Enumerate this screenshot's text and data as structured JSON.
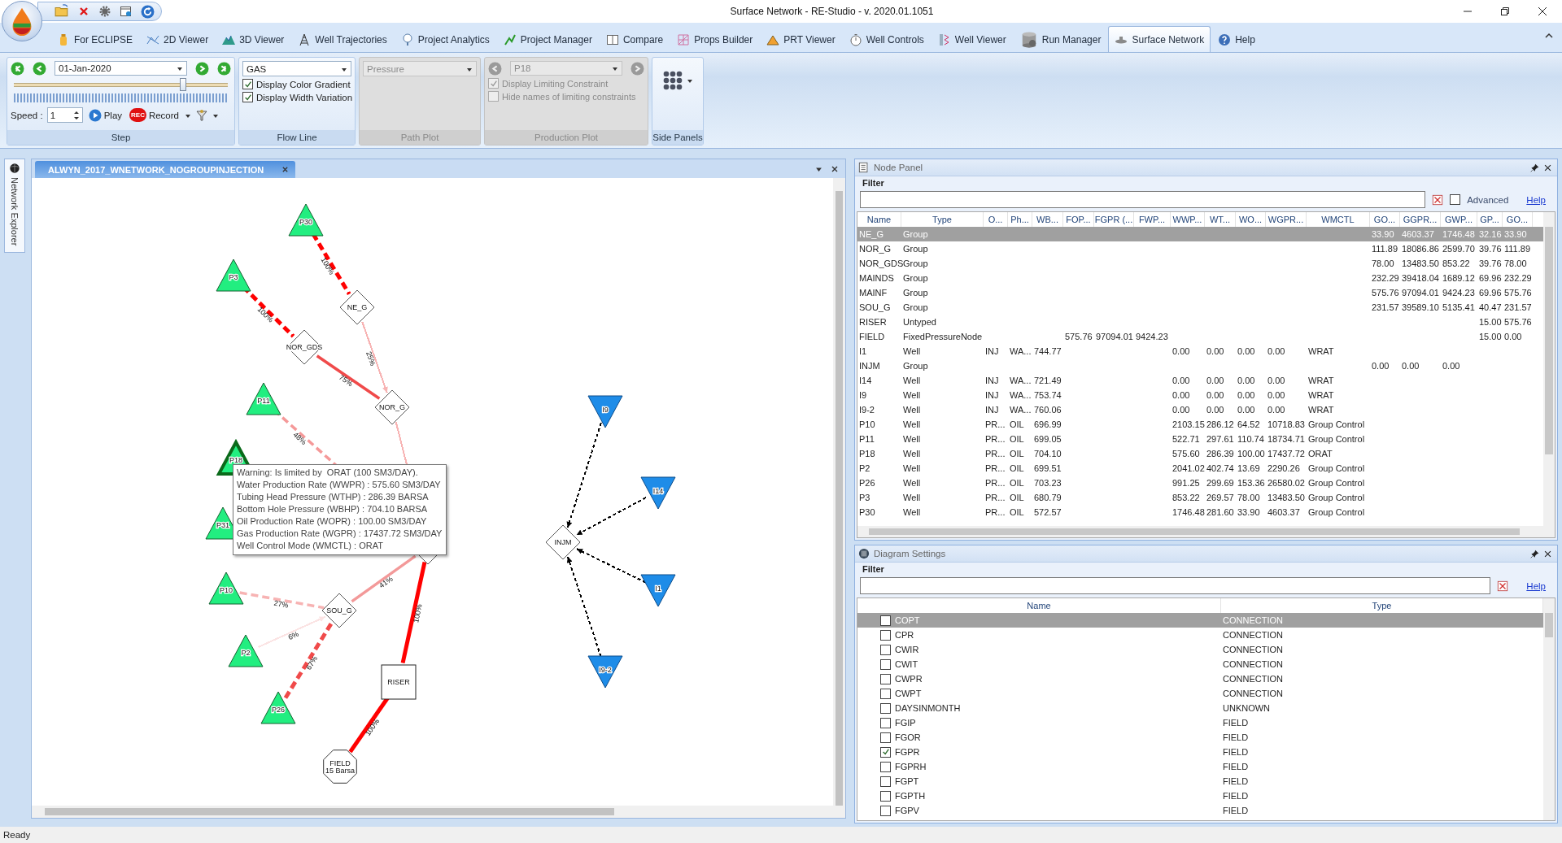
{
  "window": {
    "title": "Surface Network - RE-Studio - v. 2020.01.1051"
  },
  "ribbon": {
    "tabs": [
      {
        "label": "For ECLIPSE",
        "selected": false
      },
      {
        "label": "2D Viewer",
        "selected": false
      },
      {
        "label": "3D Viewer",
        "selected": false
      },
      {
        "label": "Well Trajectories",
        "selected": false
      },
      {
        "label": "Project Analytics",
        "selected": false
      },
      {
        "label": "Project Manager",
        "selected": false
      },
      {
        "label": "Compare",
        "selected": false
      },
      {
        "label": "Props Builder",
        "selected": false
      },
      {
        "label": "PRT Viewer",
        "selected": false
      },
      {
        "label": "Well Controls",
        "selected": false
      },
      {
        "label": "Well Viewer",
        "selected": false
      },
      {
        "label": "Run Manager",
        "selected": false
      },
      {
        "label": "Surface Network",
        "selected": true
      },
      {
        "label": "Help",
        "selected": false
      }
    ],
    "step": {
      "label": "Step",
      "date": "01-Jan-2020",
      "slider": {
        "level": 0.79
      },
      "speed_label": "Speed :",
      "speed": "1",
      "play": "Play",
      "record_badge": "REC",
      "record": "Record"
    },
    "flow_line": {
      "label": "Flow Line",
      "fluid": "GAS",
      "options": [
        {
          "label": "Display Color Gradient",
          "checked": true
        },
        {
          "label": "Display Width Variation",
          "checked": true
        }
      ]
    },
    "path_plot": {
      "label": "Path Plot",
      "variable": "Pressure",
      "disabled": true
    },
    "production_plot": {
      "label": "Production Plot",
      "well": "P18",
      "disabled": true,
      "options": [
        {
          "label": "Display Limiting Constraint",
          "checked": true
        },
        {
          "label": "Hide names of limiting constraints",
          "checked": false
        }
      ]
    },
    "side_panels": {
      "label": "Side Panels"
    }
  },
  "sidebar": {
    "tabs": [
      {
        "label": "Network Explorer"
      }
    ]
  },
  "document": {
    "tab": "ALWYN_2017_WNETWORK_NOGROUPINJECTION",
    "nodes": [
      {
        "name": "P30",
        "kind": "producer",
        "highlighted": false
      },
      {
        "name": "P3",
        "kind": "producer",
        "highlighted": false
      },
      {
        "name": "NE_G",
        "kind": "group",
        "highlighted": false
      },
      {
        "name": "NOR_GDS",
        "kind": "group",
        "highlighted": false
      },
      {
        "name": "NOR_G",
        "kind": "group",
        "highlighted": false
      },
      {
        "name": "P11",
        "kind": "producer",
        "highlighted": false
      },
      {
        "name": "P18",
        "kind": "producer",
        "highlighted": true
      },
      {
        "name": "P31",
        "kind": "producer",
        "highlighted": false
      },
      {
        "kind": "group",
        "highlighted": false
      },
      {
        "name": "P10",
        "kind": "producer",
        "highlighted": false
      },
      {
        "name": "SOU_G",
        "kind": "group",
        "highlighted": false
      },
      {
        "name": "P2",
        "kind": "producer",
        "highlighted": false
      },
      {
        "name": "P26",
        "kind": "producer",
        "highlighted": false
      },
      {
        "name": "RISER",
        "kind": "riser",
        "highlighted": false
      },
      {
        "name": "FIELD",
        "subtitle": "15 Barsa",
        "kind": "field",
        "highlighted": false
      },
      {
        "name": "INJM",
        "kind": "group",
        "highlighted": false
      },
      {
        "name": "I9",
        "kind": "injector",
        "highlighted": false
      },
      {
        "name": "I14",
        "kind": "injector",
        "highlighted": false
      },
      {
        "name": "I1",
        "kind": "injector",
        "highlighted": false
      },
      {
        "name": "I9-2",
        "kind": "injector",
        "highlighted": false
      }
    ],
    "edges": [
      {
        "label": "100%",
        "color": "#ff0000",
        "dashed": true,
        "kind": "heavy"
      },
      {
        "label": "100%",
        "color": "#ff0000",
        "dashed": true,
        "kind": "heavy"
      },
      {
        "label": "25%",
        "color": "#f7b3b3",
        "dashed": false,
        "kind": "light"
      },
      {
        "label": "75%",
        "color": "#f04a4a",
        "dashed": false,
        "kind": "medium"
      },
      {
        "color": "#f7b3b3",
        "dashed": false,
        "kind": "light"
      },
      {
        "label": "48%",
        "color": "#f59999",
        "dashed": true,
        "kind": "medium"
      },
      {
        "label": "41%",
        "color": "#f39999",
        "dashed": false,
        "kind": "medium"
      },
      {
        "label": "27%",
        "color": "#f7b3b3",
        "dashed": true,
        "kind": "medium"
      },
      {
        "label": "6%",
        "color": "#fbe3e3",
        "dashed": false,
        "kind": "light"
      },
      {
        "label": "67%",
        "color": "#f04a4a",
        "dashed": true,
        "kind": "heavy"
      },
      {
        "label": "100%",
        "color": "#ff0000",
        "dashed": false,
        "kind": "heavy"
      },
      {
        "label": "100%",
        "color": "#ff0000",
        "dashed": false,
        "kind": "heavy"
      },
      {
        "color": "#000000",
        "dashed": true,
        "kind": "light"
      },
      {
        "color": "#000000",
        "dashed": true,
        "kind": "light"
      },
      {
        "color": "#000000",
        "dashed": true,
        "kind": "light"
      },
      {
        "color": "#000000",
        "dashed": true,
        "kind": "light"
      }
    ],
    "tooltip": {
      "lines": [
        "Warning: Is limited by  ORAT (100 SM3/DAY).",
        "Water Production Rate (WWPR) : 575.60 SM3/DAY",
        "Tubing Head Pressure (WTHP) : 286.39 BARSA",
        "Bottom Hole Pressure (WBHP) : 704.10 BARSA",
        "Oil Production Rate (WOPR) : 100.00 SM3/DAY",
        "Gas Production Rate (WGPR) : 17437.72 SM3/DAY",
        "Well Control Mode (WMCTL) : ORAT"
      ]
    }
  },
  "node_panel": {
    "title": "Node Panel",
    "filter": {
      "label": "Filter",
      "advanced": {
        "label": "Advanced",
        "checked": false
      },
      "help": "Help"
    },
    "table": {
      "columns": [
        "Name",
        "Type",
        "O...",
        "Ph...",
        "WB...",
        "FOP...",
        "FGPR (...",
        "FWP...",
        "WWP...",
        "WT...",
        "WO...",
        "WGPR...",
        "WMCTL",
        "GO...",
        "GGPR...",
        "GWP...",
        "GP...",
        "GO..."
      ],
      "rows": [
        {
          "selected": true,
          "cells": [
            "NE_G",
            "Group",
            null,
            null,
            null,
            null,
            null,
            null,
            null,
            null,
            null,
            null,
            null,
            "33.90",
            "4603.37",
            "1746.48",
            "32.16",
            "33.90"
          ]
        },
        {
          "selected": false,
          "cells": [
            "NOR_G",
            "Group",
            null,
            null,
            null,
            null,
            null,
            null,
            null,
            null,
            null,
            null,
            null,
            "111.89",
            "18086.86",
            "2599.70",
            "39.76",
            "111.89"
          ]
        },
        {
          "selected": false,
          "cells": [
            "NOR_GDS",
            "Group",
            null,
            null,
            null,
            null,
            null,
            null,
            null,
            null,
            null,
            null,
            null,
            "78.00",
            "13483.50",
            "853.22",
            "39.76",
            "78.00"
          ]
        },
        {
          "selected": false,
          "cells": [
            "MAINDS",
            "Group",
            null,
            null,
            null,
            null,
            null,
            null,
            null,
            null,
            null,
            null,
            null,
            "232.29",
            "39418.04",
            "1689.12",
            "69.96",
            "232.29"
          ]
        },
        {
          "selected": false,
          "cells": [
            "MAINF",
            "Group",
            null,
            null,
            null,
            null,
            null,
            null,
            null,
            null,
            null,
            null,
            null,
            "575.76",
            "97094.01",
            "9424.23",
            "69.96",
            "575.76"
          ]
        },
        {
          "selected": false,
          "cells": [
            "SOU_G",
            "Group",
            null,
            null,
            null,
            null,
            null,
            null,
            null,
            null,
            null,
            null,
            null,
            "231.57",
            "39589.10",
            "5135.41",
            "40.47",
            "231.57"
          ]
        },
        {
          "selected": false,
          "cells": [
            "RISER",
            "Untyped",
            null,
            null,
            null,
            null,
            null,
            null,
            null,
            null,
            null,
            null,
            null,
            null,
            null,
            null,
            "15.00",
            "575.76"
          ]
        },
        {
          "selected": false,
          "cells": [
            "FIELD",
            "FixedPressureNode",
            null,
            null,
            null,
            "575.76",
            "97094.01",
            "9424.23",
            null,
            null,
            null,
            null,
            null,
            null,
            null,
            null,
            "15.00",
            "0.00"
          ]
        },
        {
          "selected": false,
          "cells": [
            "I1",
            "Well",
            "INJ",
            "WA...",
            "744.77",
            null,
            null,
            null,
            "0.00",
            "0.00",
            "0.00",
            "0.00",
            "WRAT",
            null,
            null,
            null,
            null,
            null
          ]
        },
        {
          "selected": false,
          "cells": [
            "INJM",
            "Group",
            null,
            null,
            null,
            null,
            null,
            null,
            null,
            null,
            null,
            null,
            null,
            "0.00",
            "0.00",
            "0.00",
            null,
            null
          ]
        },
        {
          "selected": false,
          "cells": [
            "I14",
            "Well",
            "INJ",
            "WA...",
            "721.49",
            null,
            null,
            null,
            "0.00",
            "0.00",
            "0.00",
            "0.00",
            "WRAT",
            null,
            null,
            null,
            null,
            null
          ]
        },
        {
          "selected": false,
          "cells": [
            "I9",
            "Well",
            "INJ",
            "WA...",
            "753.74",
            null,
            null,
            null,
            "0.00",
            "0.00",
            "0.00",
            "0.00",
            "WRAT",
            null,
            null,
            null,
            null,
            null
          ]
        },
        {
          "selected": false,
          "cells": [
            "I9-2",
            "Well",
            "INJ",
            "WA...",
            "760.06",
            null,
            null,
            null,
            "0.00",
            "0.00",
            "0.00",
            "0.00",
            "WRAT",
            null,
            null,
            null,
            null,
            null
          ]
        },
        {
          "selected": false,
          "cells": [
            "P10",
            "Well",
            "PR...",
            "OIL",
            "696.99",
            null,
            null,
            null,
            "2103.15",
            "286.12",
            "64.52",
            "10718.83",
            "Group Control",
            null,
            null,
            null,
            null,
            null
          ]
        },
        {
          "selected": false,
          "cells": [
            "P11",
            "Well",
            "PR...",
            "OIL",
            "699.05",
            null,
            null,
            null,
            "522.71",
            "297.61",
            "110.74",
            "18734.71",
            "Group Control",
            null,
            null,
            null,
            null,
            null
          ]
        },
        {
          "selected": false,
          "cells": [
            "P18",
            "Well",
            "PR...",
            "OIL",
            "704.10",
            null,
            null,
            null,
            "575.60",
            "286.39",
            "100.00",
            "17437.72",
            "ORAT",
            null,
            null,
            null,
            null,
            null
          ]
        },
        {
          "selected": false,
          "cells": [
            "P2",
            "Well",
            "PR...",
            "OIL",
            "699.51",
            null,
            null,
            null,
            "2041.02",
            "402.74",
            "13.69",
            "2290.26",
            "Group Control",
            null,
            null,
            null,
            null,
            null
          ]
        },
        {
          "selected": false,
          "cells": [
            "P26",
            "Well",
            "PR...",
            "OIL",
            "703.23",
            null,
            null,
            null,
            "991.25",
            "299.69",
            "153.36",
            "26580.02",
            "Group Control",
            null,
            null,
            null,
            null,
            null
          ]
        },
        {
          "selected": false,
          "cells": [
            "P3",
            "Well",
            "PR...",
            "OIL",
            "680.79",
            null,
            null,
            null,
            "853.22",
            "269.57",
            "78.00",
            "13483.50",
            "Group Control",
            null,
            null,
            null,
            null,
            null
          ]
        },
        {
          "selected": false,
          "cells": [
            "P30",
            "Well",
            "PR...",
            "OIL",
            "572.57",
            null,
            null,
            null,
            "1746.48",
            "281.60",
            "33.90",
            "4603.37",
            "Group Control",
            null,
            null,
            null,
            null,
            null
          ]
        }
      ]
    }
  },
  "diagram_settings": {
    "title": "Diagram Settings",
    "filter": {
      "label": "Filter",
      "help": "Help"
    },
    "table": {
      "columns": [
        "Name",
        "Type"
      ],
      "rows": [
        {
          "name": "COPT",
          "type": "CONNECTION",
          "checked": false,
          "selected": true
        },
        {
          "name": "CPR",
          "type": "CONNECTION",
          "checked": false,
          "selected": false
        },
        {
          "name": "CWIR",
          "type": "CONNECTION",
          "checked": false,
          "selected": false
        },
        {
          "name": "CWIT",
          "type": "CONNECTION",
          "checked": false,
          "selected": false
        },
        {
          "name": "CWPR",
          "type": "CONNECTION",
          "checked": false,
          "selected": false
        },
        {
          "name": "CWPT",
          "type": "CONNECTION",
          "checked": false,
          "selected": false
        },
        {
          "name": "DAYSINMONTH",
          "type": "UNKNOWN",
          "checked": false,
          "selected": false
        },
        {
          "name": "FGIP",
          "type": "FIELD",
          "checked": false,
          "selected": false
        },
        {
          "name": "FGOR",
          "type": "FIELD",
          "checked": false,
          "selected": false
        },
        {
          "name": "FGPR",
          "type": "FIELD",
          "checked": true,
          "selected": false
        },
        {
          "name": "FGPRH",
          "type": "FIELD",
          "checked": false,
          "selected": false
        },
        {
          "name": "FGPT",
          "type": "FIELD",
          "checked": false,
          "selected": false
        },
        {
          "name": "FGPTH",
          "type": "FIELD",
          "checked": false,
          "selected": false
        },
        {
          "name": "FGPV",
          "type": "FIELD",
          "checked": false,
          "selected": false
        }
      ]
    }
  },
  "status_bar": "Ready"
}
